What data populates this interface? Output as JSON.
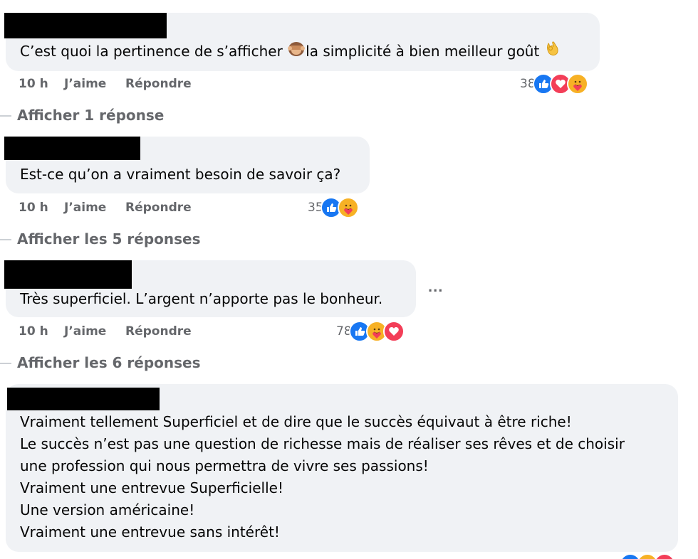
{
  "comments": [
    {
      "text": "C’est quoi la pertinence de s’afficher ",
      "text_b": "la simplicité à bien meilleur goût ",
      "time": "10 h",
      "like": "J’aime",
      "reply": "Répondre",
      "reaction_count": "38",
      "reactions": [
        "like-icon",
        "love-icon",
        "care-icon"
      ]
    },
    {
      "text": "Est-ce qu’on a vraiment besoin de savoir ça?",
      "time": "10 h",
      "like": "J’aime",
      "reply": "Répondre",
      "reaction_count": "35",
      "reactions": [
        "like-icon",
        "care-icon"
      ]
    },
    {
      "text": "Très superficiel. L’argent n’apporte pas le bonheur.",
      "time": "10 h",
      "like": "J’aime",
      "reply": "Répondre",
      "reaction_count": "78",
      "reactions": [
        "like-icon",
        "care-icon",
        "love-icon"
      ]
    },
    {
      "text": "Vraiment tellement Superficiel et de dire que le succès équivaut à être riche!\nLe succès n’est pas une question de richesse mais de réaliser ses rêves et de choisir\nune profession qui nous permettra de vivre ses passions!\nVraiment une entrevue Superficielle!\nUne version américaine!\nVraiment une entrevue sans intérêt!"
    }
  ],
  "replies_links": [
    "Afficher 1 réponse",
    "Afficher les 5 réponses",
    "Afficher les 6 réponses"
  ],
  "more_options": "...",
  "colors": {
    "bubble": "#f0f2f5",
    "meta": "#65676b",
    "like": "#1877f2",
    "love": "#f33e58",
    "care": "#f7b125"
  }
}
